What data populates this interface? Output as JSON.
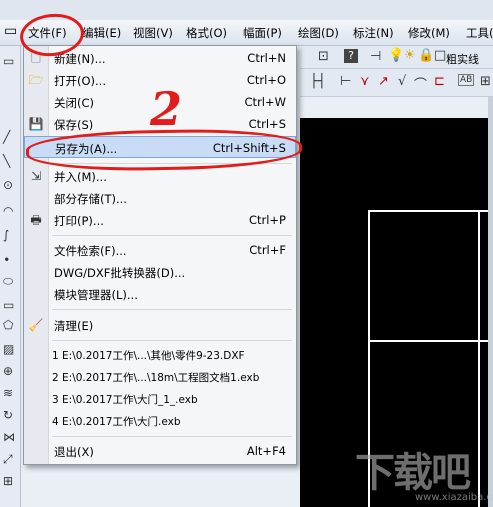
{
  "menubar": {
    "items": [
      "文件(F)",
      "编辑(E)",
      "视图(V)",
      "格式(O)",
      "幅面(P)",
      "绘图(D)",
      "标注(N)",
      "修改(M)",
      "工具("
    ]
  },
  "toolbar": {
    "coarse_solid_label": "粗实线"
  },
  "file_menu": {
    "items": [
      {
        "label": "新建(N)...",
        "shortcut": "Ctrl+N",
        "icon": "new-file-icon"
      },
      {
        "label": "打开(O)...",
        "shortcut": "Ctrl+O",
        "icon": "open-folder-icon"
      },
      {
        "label": "关闭(C)",
        "shortcut": "Ctrl+W",
        "icon": ""
      },
      {
        "label": "保存(S)",
        "shortcut": "Ctrl+S",
        "icon": "save-disk-icon"
      },
      {
        "label": "另存为(A)...",
        "shortcut": "Ctrl+Shift+S",
        "icon": ""
      },
      {
        "label": "并入(M)...",
        "shortcut": "",
        "icon": "merge-icon"
      },
      {
        "label": "部分存储(T)...",
        "shortcut": "",
        "icon": ""
      },
      {
        "label": "打印(P)...",
        "shortcut": "Ctrl+P",
        "icon": "printer-icon"
      },
      {
        "label": "文件检索(F)...",
        "shortcut": "Ctrl+F",
        "icon": ""
      },
      {
        "label": "DWG/DXF批转换器(D)...",
        "shortcut": "",
        "icon": ""
      },
      {
        "label": "模块管理器(L)...",
        "shortcut": "",
        "icon": ""
      },
      {
        "label": "清理(E)",
        "shortcut": "",
        "icon": "purge-icon"
      },
      {
        "label": "1 E:\\0.2017工作\\...\\其他\\零件9-23.DXF",
        "shortcut": "",
        "icon": ""
      },
      {
        "label": "2 E:\\0.2017工作\\...\\18m\\工程图文档1.exb",
        "shortcut": "",
        "icon": ""
      },
      {
        "label": "3 E:\\0.2017工作\\大门_1_.exb",
        "shortcut": "",
        "icon": ""
      },
      {
        "label": "4 E:\\0.2017工作\\大门.exb",
        "shortcut": "",
        "icon": ""
      },
      {
        "label": "退出(X)",
        "shortcut": "Alt+F4",
        "icon": ""
      }
    ]
  },
  "annotation": {
    "step_number": "2"
  },
  "watermark": {
    "cn": "下载吧",
    "en": "www.xiazaiba.com"
  },
  "colors": {
    "annotation_red": "#e21b1b",
    "highlight": "#c8dcf5",
    "canvas": "#000000"
  }
}
